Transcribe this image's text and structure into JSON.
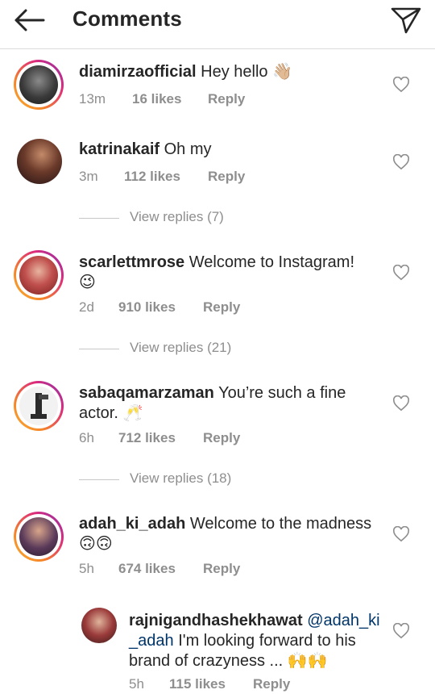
{
  "header": {
    "title": "Comments"
  },
  "comments": [
    {
      "username": "diamirzaofficial",
      "text": "Hey hello",
      "emoji": "👋🏼",
      "time": "13m",
      "likes": "16 likes",
      "reply": "Reply"
    },
    {
      "username": "katrinakaif",
      "text": "Oh my",
      "time": "3m",
      "likes": "112 likes",
      "reply": "Reply",
      "view_replies": "View replies (7)"
    },
    {
      "username": "scarlettmrose",
      "text": "Welcome to Instagram!",
      "emoji": "😉",
      "time": "2d",
      "likes": "910 likes",
      "reply": "Reply",
      "view_replies": "View replies (21)"
    },
    {
      "username": "sabaqamarzaman",
      "text": "You’re such a fine actor.",
      "emoji": "🥂",
      "time": "6h",
      "likes": "712 likes",
      "reply": "Reply",
      "view_replies": "View replies (18)"
    },
    {
      "username": "adah_ki_adah",
      "text": "Welcome to the madness",
      "emoji": "🙃🙃",
      "time": "5h",
      "likes": "674 likes",
      "reply": "Reply"
    }
  ],
  "reply_comment": {
    "username": "rajnigandhashekhawat",
    "mention": "@adah_ki_adah",
    "text": "I'm looking forward to his brand of crazyness ...",
    "emoji": "🙌🙌",
    "time": "5h",
    "likes": "115 likes",
    "reply": "Reply"
  }
}
